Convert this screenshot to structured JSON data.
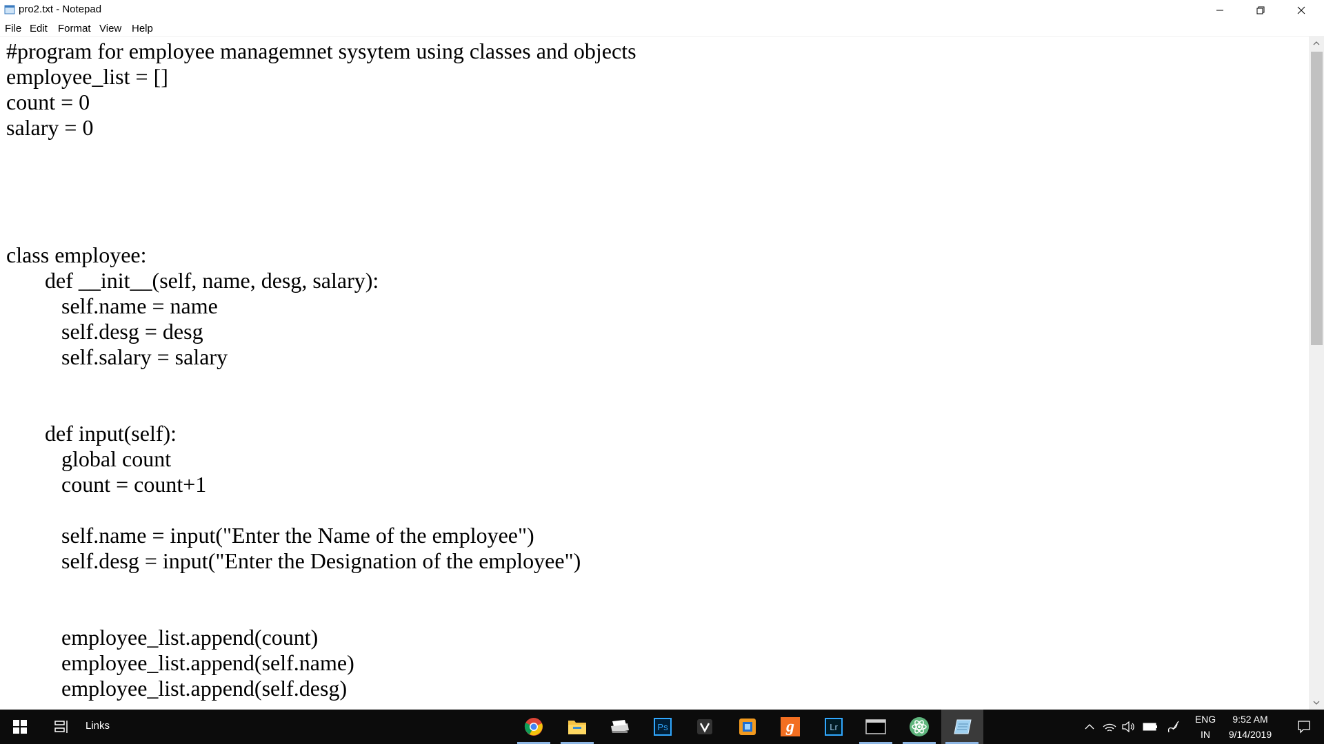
{
  "window": {
    "title": "pro2.txt - Notepad"
  },
  "menu": [
    "File",
    "Edit",
    "Format",
    "View",
    "Help"
  ],
  "editor": {
    "lines": [
      "#program for employee managemnet sysytem using classes and objects",
      "employee_list = []",
      "count = 0",
      "salary = 0",
      "",
      "",
      "",
      "",
      "class employee:",
      "       def __init__(self, name, desg, salary):",
      "          self.name = name",
      "          self.desg = desg",
      "          self.salary = salary",
      "",
      "",
      "       def input(self):",
      "          global count",
      "          count = count+1",
      "",
      "          self.name = input(\"Enter the Name of the employee\")",
      "          self.desg = input(\"Enter the Designation of the employee\")",
      "",
      "",
      "          employee_list.append(count)",
      "          employee_list.append(self.name)",
      "          employee_list.append(self.desg)"
    ]
  },
  "taskbar": {
    "links_label": "Links",
    "apps": [
      {
        "name": "chrome-icon",
        "label": ""
      },
      {
        "name": "file-explorer-icon",
        "label": ""
      },
      {
        "name": "scanner-icon",
        "label": ""
      },
      {
        "name": "photoshop-icon",
        "label": "Ps"
      },
      {
        "name": "vectornator-icon",
        "label": ""
      },
      {
        "name": "office-icon",
        "label": ""
      },
      {
        "name": "gmail-g-icon",
        "label": "g"
      },
      {
        "name": "lightroom-icon",
        "label": "Lr"
      },
      {
        "name": "terminal-icon",
        "label": ""
      },
      {
        "name": "atom-icon",
        "label": ""
      },
      {
        "name": "notepad-icon",
        "label": ""
      }
    ],
    "tray": {
      "language": "ENG",
      "region": "IN",
      "time": "9:52 AM",
      "date": "9/14/2019"
    }
  },
  "colors": {
    "taskbar_bg": "#0c0c0c",
    "accent_underline": "#8eb6e3",
    "scroll_thumb": "#c1c1c1"
  }
}
